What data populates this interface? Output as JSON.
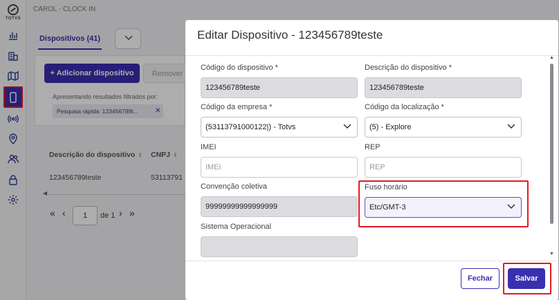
{
  "app": {
    "title": "CAROL - CLOCK IN",
    "logo_text": "TOTVS",
    "tab_label": "Dispositivos (41)",
    "add_button": "+ Adicionar dispositivo",
    "remove_button": "Remover",
    "filter_label": "Apresentando resultados filtrados por:",
    "filter_chip": "Pesquisa rápida: 123456789t...",
    "table": {
      "headers": [
        "Descrição do dispositivo",
        "CNPJ"
      ],
      "rows": [
        [
          "123456789teste",
          "53113791"
        ]
      ]
    },
    "pagination": {
      "current_page": "1",
      "of_text": "de 1"
    }
  },
  "modal": {
    "title": "Editar Dispositivo - 123456789teste",
    "fields": {
      "codigo_dispositivo": {
        "label": "Código do dispositivo *",
        "value": "123456789teste"
      },
      "descricao_dispositivo": {
        "label": "Descrição do dispositivo *",
        "value": "123456789teste"
      },
      "codigo_empresa": {
        "label": "Código da empresa *",
        "value": "(53113791000122|) - Totvs"
      },
      "codigo_localizacao": {
        "label": "Código da localização *",
        "value": "(5) - Explore"
      },
      "imei": {
        "label": "IMEI",
        "placeholder": "IMEI"
      },
      "rep": {
        "label": "REP",
        "placeholder": "REP"
      },
      "convencao_coletiva": {
        "label": "Convenção coletiva",
        "value": "99999999999999999"
      },
      "fuso_horario": {
        "label": "Fuso horário",
        "value": "Etc/GMT-3"
      },
      "sistema_operacional": {
        "label": "Sistema Operacional",
        "value": ""
      }
    },
    "buttons": {
      "close": "Fechar",
      "save": "Salvar"
    }
  },
  "colors": {
    "primary": "#3a2fb0",
    "highlight": "#e01c24",
    "disabled_field": "#dcdce0"
  }
}
